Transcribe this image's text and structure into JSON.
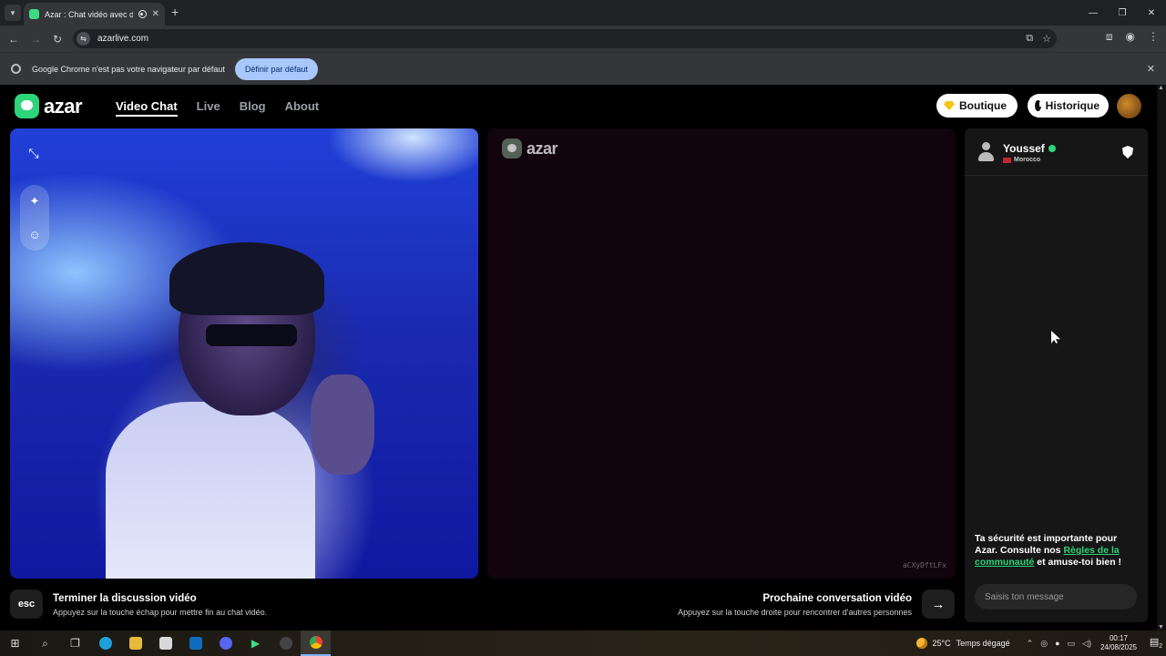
{
  "browser": {
    "tab_title": "Azar : Chat vidéo avec de n",
    "url": "azarlive.com",
    "infobar_text": "Google Chrome n'est pas votre navigateur par défaut",
    "infobar_button": "Définir par défaut"
  },
  "header": {
    "logo_text": "azar",
    "nav": [
      "Video Chat",
      "Live",
      "Blog",
      "About"
    ],
    "active_nav": "Video Chat",
    "shop_label": "Boutique",
    "history_label": "Historique"
  },
  "video_remote": {
    "logo_text": "azar",
    "session_id": "aCXyDftLFx"
  },
  "chat": {
    "user_name": "Youssef",
    "country": "Morocco",
    "safety_text_1": "Ta sécurité est importante pour Azar. Consulte nos ",
    "safety_link": "Règles de la communauté",
    "safety_text_2": " et amuse-toi bien !",
    "input_placeholder": "Saisis ton message"
  },
  "hints": {
    "esc_key": "esc",
    "end_title": "Terminer la discussion vidéo",
    "end_sub": "Appuyez sur la touche échap pour mettre fin au chat vidéo.",
    "next_title": "Prochaine conversation vidéo",
    "next_sub": "Appuyez sur la touche droite pour rencontrer d'autres personnes"
  },
  "taskbar": {
    "weather_temp": "25°C",
    "weather_desc": "Temps dégagé",
    "time": "00:17",
    "date": "24/08/2025",
    "notification_count": "2"
  },
  "colors": {
    "brand_green": "#2ed47a",
    "infobar_button": "#a8c7fa"
  }
}
